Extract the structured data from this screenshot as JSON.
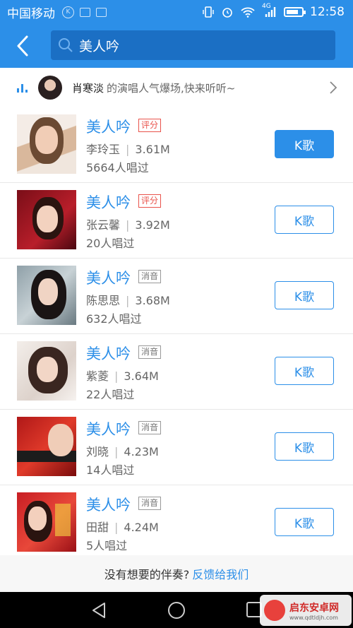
{
  "status_bar": {
    "carrier": "中国移动",
    "network": "4G",
    "time": "12:58",
    "battery_level": 0.85
  },
  "search": {
    "query": "美人吟"
  },
  "banner": {
    "artist": "肖寒淡",
    "text": "的演唱人气爆场,快来听听~"
  },
  "songs": [
    {
      "title": "美人吟",
      "tag": "评分",
      "singer": "李玲玉",
      "size": "3.61M",
      "count": "5664人唱过",
      "button": "K歌"
    },
    {
      "title": "美人吟",
      "tag": "评分",
      "singer": "张云馨",
      "size": "3.92M",
      "count": "20人唱过",
      "button": "K歌"
    },
    {
      "title": "美人吟",
      "tag": "消音",
      "singer": "陈思思",
      "size": "3.68M",
      "count": "632人唱过",
      "button": "K歌"
    },
    {
      "title": "美人吟",
      "tag": "消音",
      "singer": "紫菱",
      "size": "3.64M",
      "count": "22人唱过",
      "button": "K歌"
    },
    {
      "title": "美人吟",
      "tag": "消音",
      "singer": "刘晓",
      "size": "4.23M",
      "count": "14人唱过",
      "button": "K歌"
    },
    {
      "title": "美人吟",
      "tag": "消音",
      "singer": "田甜",
      "size": "4.24M",
      "count": "5人唱过",
      "button": "K歌"
    }
  ],
  "footer": {
    "question": "没有想要的伴奏?",
    "link": "反馈给我们"
  },
  "watermark": {
    "name": "启东安卓网",
    "url": "www.qdtldjh.com"
  },
  "colors": {
    "accent": "#2c8fe8",
    "tag_red": "#e9534b"
  }
}
